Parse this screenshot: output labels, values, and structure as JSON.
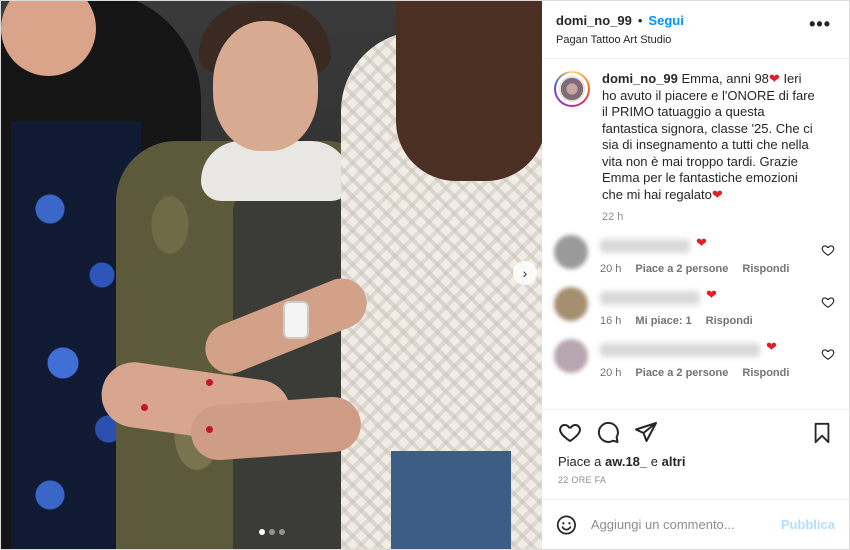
{
  "header": {
    "username": "domi_no_99",
    "separator": "•",
    "follow_label": "Segui",
    "location": "Pagan Tattoo Art Studio",
    "more_label": "•••"
  },
  "caption": {
    "username": "domi_no_99",
    "text_part1": "Emma, anni 98",
    "text_part2": " Ieri ho avuto il piacere e l'ONORE di fare il PRIMO tatuaggio a questa fantastica signora, classe '25. Che ci sia di insegnamento a tutti che nella vita non è mai troppo tardi. Grazie Emma per le fantastiche emozioni che mi hai regalato",
    "heart": "❤",
    "time": "22 h"
  },
  "comments": [
    {
      "time": "20 h",
      "likes": "Piace a 2 persone",
      "reply": "Rispondi",
      "heart": "❤",
      "avatar_color": "#9a9a9a"
    },
    {
      "time": "16 h",
      "likes": "Mi piace: 1",
      "reply": "Rispondi",
      "heart": "❤",
      "avatar_color": "#a58f70"
    },
    {
      "time": "20 h",
      "likes": "Piace a 2 persone",
      "reply": "Rispondi",
      "heart": "❤",
      "avatar_color": "#b8a6b0"
    }
  ],
  "likes": {
    "prefix": "Piace a ",
    "user": "aw.18_",
    "middle": " e ",
    "others": "altri"
  },
  "ago": "22 ORE FA",
  "add_comment": {
    "placeholder": "Aggiungi un commento...",
    "publish_label": "Pubblica"
  },
  "carousel": {
    "slide_count": 3,
    "active_index": 0
  },
  "colors": {
    "accent": "#0095f6",
    "heart": "#e11d2a",
    "publish_disabled": "#b2dffc"
  },
  "icons": [
    "heart-icon",
    "comment-icon",
    "share-icon",
    "bookmark-icon",
    "emoji-icon",
    "more-options-icon",
    "next-arrow-icon"
  ]
}
